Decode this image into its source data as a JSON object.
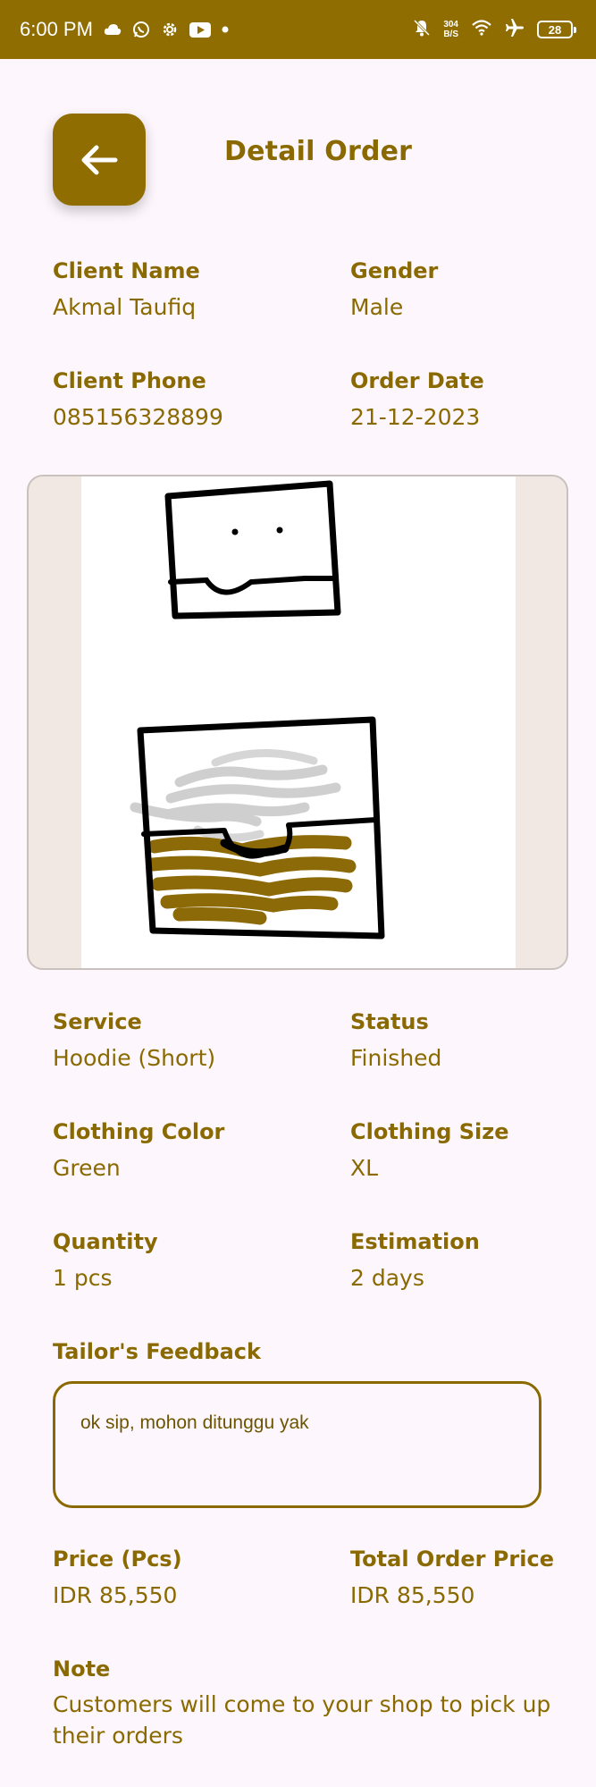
{
  "status_bar": {
    "time": "6:00 PM",
    "net_speed_value": "304",
    "net_speed_unit": "B/S",
    "battery_level": "28",
    "icons": [
      "cloud-icon",
      "whatsapp-icon",
      "settings-icon",
      "youtube-icon",
      "dot-icon",
      "mute-icon",
      "wifi-icon",
      "airplane-icon",
      "battery-icon"
    ]
  },
  "header": {
    "title": "Detail Order",
    "back_icon": "arrow-left-icon"
  },
  "client": {
    "name_label": "Client Name",
    "name": "Akmal Taufiq",
    "gender_label": "Gender",
    "gender": "Male",
    "phone_label": "Client Phone",
    "phone": "085156328899",
    "date_label": "Order Date",
    "date": "21-12-2023"
  },
  "order": {
    "service_label": "Service",
    "service": "Hoodie (Short)",
    "status_label": "Status",
    "status": "Finished",
    "color_label": "Clothing Color",
    "color": "Green",
    "size_label": "Clothing Size",
    "size": "XL",
    "quantity_label": "Quantity",
    "quantity": "1 pcs",
    "estimation_label": "Estimation",
    "estimation": "2 days"
  },
  "feedback": {
    "label": "Tailor's Feedback",
    "text": "ok sip, mohon ditunggu yak"
  },
  "pricing": {
    "price_label": "Price (Pcs)",
    "price": "IDR 85,550",
    "total_label": "Total Order Price",
    "total": "IDR 85,550"
  },
  "note": {
    "label": "Note",
    "text": "Customers will come to your shop to pick up their orders"
  },
  "colors": {
    "primary": "#8f6d00",
    "text": "#8a6a00",
    "background": "#fdf7fd",
    "sketch_gray": "#cccccc",
    "sketch_brown": "#8d6a08"
  }
}
